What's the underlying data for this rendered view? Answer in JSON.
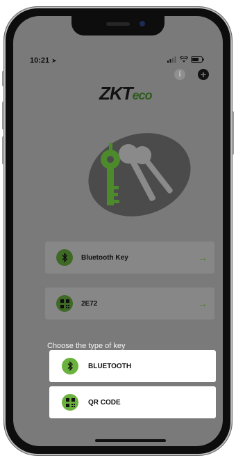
{
  "status": {
    "time": "10:21"
  },
  "brand": {
    "logo_prefix": "ZKT",
    "logo_suffix": "eco"
  },
  "keys": [
    {
      "label": "Bluetooth Key",
      "icon": "bluetooth-icon"
    },
    {
      "label": "2E72",
      "icon": "qr-code-icon"
    }
  ],
  "picker": {
    "title": "Choose the type of key",
    "options": [
      {
        "label": "BLUETOOTH",
        "icon": "bluetooth-icon"
      },
      {
        "label": "QR CODE",
        "icon": "qr-code-icon"
      }
    ]
  },
  "colors": {
    "accent": "#6ab23d",
    "accent_dark": "#3e6a25",
    "overlay": "#7a7a7a"
  }
}
